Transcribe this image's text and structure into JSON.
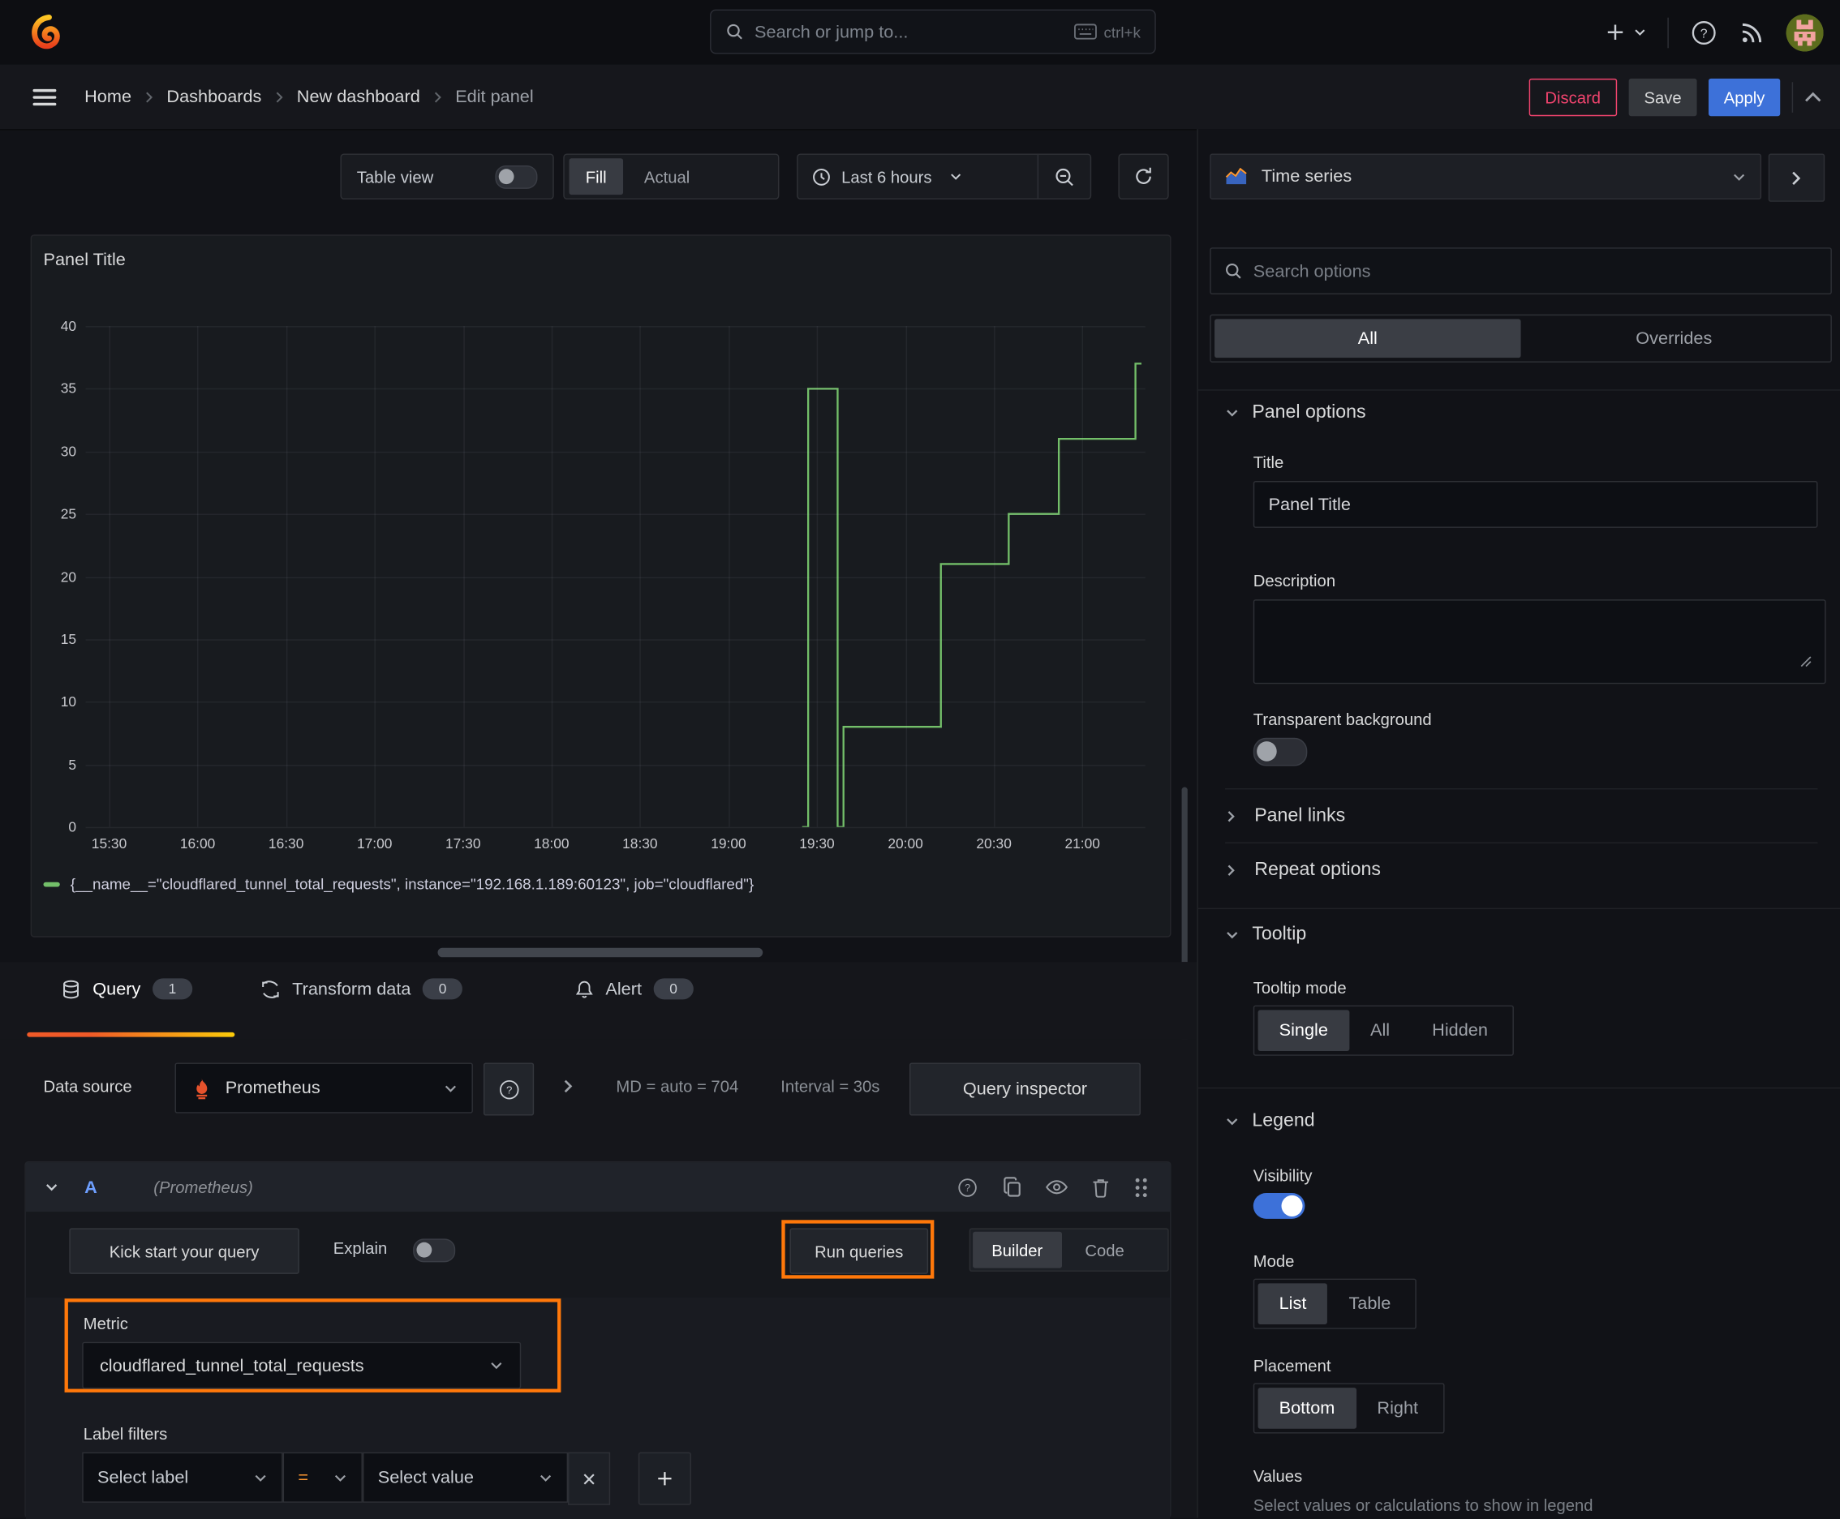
{
  "topbar": {
    "search_placeholder": "Search or jump to...",
    "search_shortcut": "ctrl+k"
  },
  "breadcrumb": {
    "items": [
      "Home",
      "Dashboards",
      "New dashboard",
      "Edit panel"
    ]
  },
  "actions": {
    "discard": "Discard",
    "save": "Save",
    "apply": "Apply"
  },
  "panel_toolbar": {
    "table_view": "Table view",
    "fill": "Fill",
    "actual": "Actual",
    "time_range": "Last 6 hours"
  },
  "viz_picker": {
    "label": "Time series"
  },
  "chart_data": {
    "type": "line",
    "title": "Panel Title",
    "x_ticks": [
      "15:30",
      "16:00",
      "16:30",
      "17:00",
      "17:30",
      "18:00",
      "18:30",
      "19:00",
      "19:30",
      "20:00",
      "20:30",
      "21:00"
    ],
    "y_ticks": [
      0,
      5,
      10,
      15,
      20,
      25,
      30,
      35,
      40
    ],
    "ylim": [
      0,
      40
    ],
    "xlabel": "",
    "ylabel": "",
    "grid": true,
    "legend_position": "bottom",
    "series": [
      {
        "name": "{__name__=\"cloudflared_tunnel_total_requests\", instance=\"192.168.1.189:60123\", job=\"cloudflared\"}",
        "color": "#73bf69",
        "points": [
          [
            "19:25",
            0
          ],
          [
            "19:27",
            0
          ],
          [
            "19:27",
            35
          ],
          [
            "19:37",
            35
          ],
          [
            "19:37",
            0
          ],
          [
            "19:39",
            0
          ],
          [
            "19:39",
            8
          ],
          [
            "20:12",
            8
          ],
          [
            "20:12",
            21
          ],
          [
            "20:35",
            21
          ],
          [
            "20:35",
            25
          ],
          [
            "20:52",
            25
          ],
          [
            "20:52",
            31
          ],
          [
            "21:18",
            31
          ],
          [
            "21:18",
            37
          ],
          [
            "21:20",
            37
          ]
        ]
      }
    ]
  },
  "query_section": {
    "tabs": [
      {
        "label": "Query",
        "badge": "1"
      },
      {
        "label": "Transform data",
        "badge": "0"
      },
      {
        "label": "Alert",
        "badge": "0"
      }
    ],
    "datasource": {
      "label": "Data source",
      "name": "Prometheus",
      "stats": "MD = auto = 704",
      "interval": "Interval = 30s",
      "inspector": "Query inspector"
    },
    "row": {
      "ref": "A",
      "datasource": "(Prometheus)"
    },
    "toolbar": {
      "kickstart": "Kick start your query",
      "explain": "Explain",
      "run": "Run queries",
      "builder": "Builder",
      "code": "Code"
    },
    "builder": {
      "metric_label": "Metric",
      "metric_value": "cloudflared_tunnel_total_requests",
      "label_filters": "Label filters",
      "select_label": "Select label",
      "operator": "=",
      "select_value": "Select value"
    }
  },
  "options_pane": {
    "search_placeholder": "Search options",
    "tabs": {
      "all": "All",
      "overrides": "Overrides"
    },
    "panel_options": {
      "header": "Panel options",
      "title_label": "Title",
      "title_value": "Panel Title",
      "description_label": "Description",
      "transparent_label": "Transparent background",
      "panel_links": "Panel links",
      "repeat_options": "Repeat options"
    },
    "tooltip": {
      "header": "Tooltip",
      "mode_label": "Tooltip mode",
      "modes": [
        "Single",
        "All",
        "Hidden"
      ]
    },
    "legend": {
      "header": "Legend",
      "visibility_label": "Visibility",
      "mode_label": "Mode",
      "modes": [
        "List",
        "Table"
      ],
      "placement_label": "Placement",
      "placements": [
        "Bottom",
        "Right"
      ],
      "values_label": "Values",
      "values_hint": "Select values or calculations to show in legend"
    }
  },
  "colors": {
    "highlight_orange": "#ff780a",
    "series_green": "#73bf69",
    "primary_blue": "#3d71d9",
    "danger_pink": "#f1446e"
  }
}
